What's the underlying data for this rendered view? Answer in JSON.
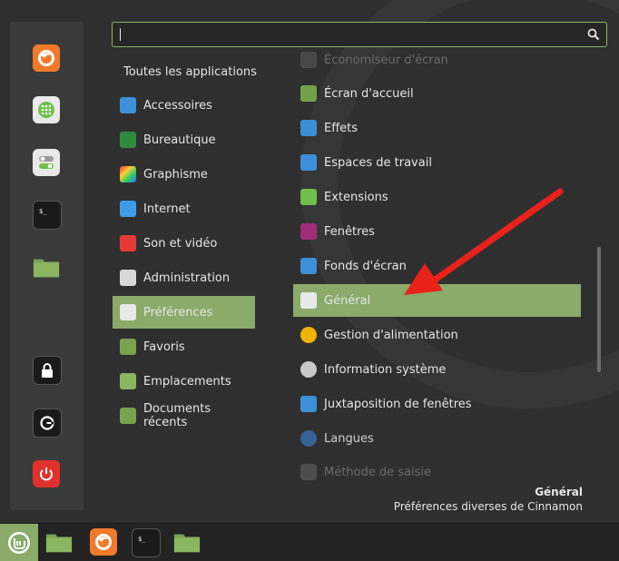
{
  "search": {
    "value": "",
    "placeholder": ""
  },
  "categories": {
    "all_label": "Toutes les applications",
    "items": [
      {
        "label": "Accessoires"
      },
      {
        "label": "Bureautique"
      },
      {
        "label": "Graphisme"
      },
      {
        "label": "Internet"
      },
      {
        "label": "Son et vidéo"
      },
      {
        "label": "Administration"
      },
      {
        "label": "Préférences"
      },
      {
        "label": "Favoris"
      },
      {
        "label": "Emplacements"
      },
      {
        "label": "Documents récents"
      }
    ]
  },
  "apps": [
    {
      "label": "Économiseur d'écran"
    },
    {
      "label": "Écran d'accueil"
    },
    {
      "label": "Effets"
    },
    {
      "label": "Espaces de travail"
    },
    {
      "label": "Extensions"
    },
    {
      "label": "Fenêtres"
    },
    {
      "label": "Fonds d'écran"
    },
    {
      "label": "Général"
    },
    {
      "label": "Gestion d'alimentation"
    },
    {
      "label": "Information système"
    },
    {
      "label": "Juxtaposition de fenêtres"
    },
    {
      "label": "Langues"
    },
    {
      "label": "Méthode de saisie"
    }
  ],
  "description": {
    "title": "Général",
    "text": "Préférences diverses de Cinnamon"
  },
  "colors": {
    "accent": "#8aab6a",
    "arrow": "#e8221b"
  }
}
